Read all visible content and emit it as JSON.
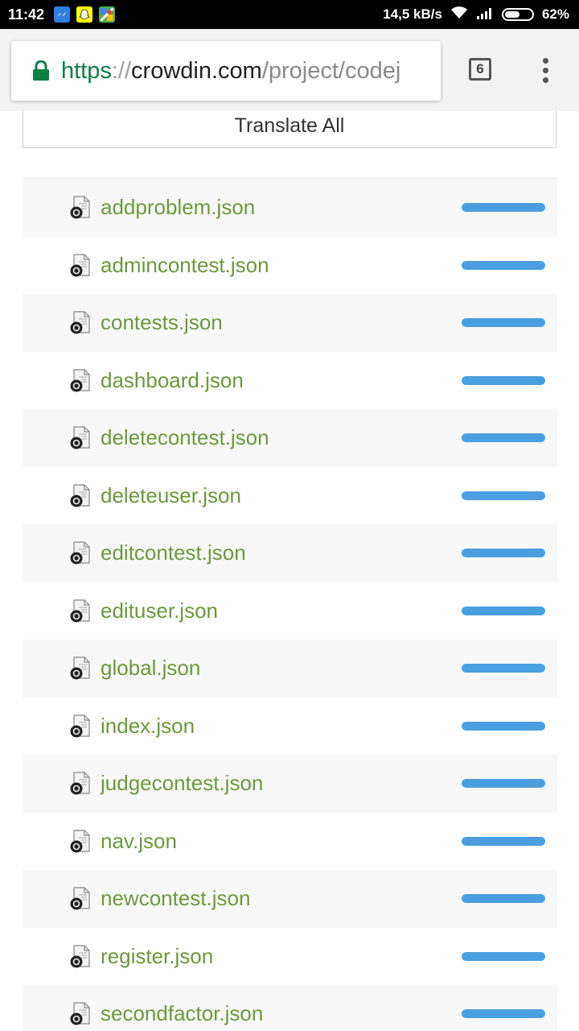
{
  "status_bar": {
    "time": "11:42",
    "speed": "14,5 kB/s",
    "battery": "62%",
    "battery_level": 0.62,
    "notification_icons": [
      "messenger-icon",
      "snapchat-icon",
      "maps-icon"
    ]
  },
  "browser": {
    "url_scheme": "https",
    "url_sep": "://",
    "url_host": "crowdin.com",
    "url_path": "/project/codej",
    "tab_count": "6",
    "colors": {
      "secure": "#0b8043"
    }
  },
  "page": {
    "translate_all_label": "Translate All",
    "colors": {
      "file_link": "#6b9a3c",
      "progress": "#4a9fe0"
    },
    "files": [
      {
        "name": "addproblem.json",
        "progress": 1.0
      },
      {
        "name": "admincontest.json",
        "progress": 1.0
      },
      {
        "name": "contests.json",
        "progress": 1.0
      },
      {
        "name": "dashboard.json",
        "progress": 1.0
      },
      {
        "name": "deletecontest.json",
        "progress": 1.0
      },
      {
        "name": "deleteuser.json",
        "progress": 1.0
      },
      {
        "name": "editcontest.json",
        "progress": 1.0
      },
      {
        "name": "edituser.json",
        "progress": 1.0
      },
      {
        "name": "global.json",
        "progress": 1.0
      },
      {
        "name": "index.json",
        "progress": 1.0
      },
      {
        "name": "judgecontest.json",
        "progress": 1.0
      },
      {
        "name": "nav.json",
        "progress": 1.0
      },
      {
        "name": "newcontest.json",
        "progress": 1.0
      },
      {
        "name": "register.json",
        "progress": 1.0
      },
      {
        "name": "secondfactor.json",
        "progress": 1.0
      }
    ]
  }
}
